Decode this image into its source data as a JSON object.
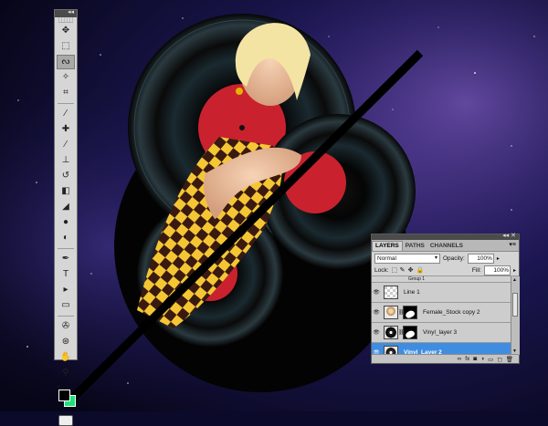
{
  "tools": {
    "header_glyph": "◂◂",
    "items": [
      {
        "name": "move-tool-icon",
        "glyph": "✥"
      },
      {
        "name": "marquee-tool-icon",
        "glyph": "⬚"
      },
      {
        "name": "lasso-tool-icon",
        "glyph": "ᔓ",
        "active": true
      },
      {
        "name": "magic-wand-tool-icon",
        "glyph": "✧"
      },
      {
        "name": "crop-tool-icon",
        "glyph": "⌗"
      },
      {
        "name": "eyedropper-tool-icon",
        "glyph": "⁄"
      },
      {
        "name": "healing-brush-tool-icon",
        "glyph": "✚"
      },
      {
        "name": "brush-tool-icon",
        "glyph": "⁄"
      },
      {
        "name": "clone-stamp-tool-icon",
        "glyph": "⊥"
      },
      {
        "name": "history-brush-tool-icon",
        "glyph": "↺"
      },
      {
        "name": "eraser-tool-icon",
        "glyph": "◧"
      },
      {
        "name": "paint-bucket-tool-icon",
        "glyph": "◢"
      },
      {
        "name": "blur-tool-icon",
        "glyph": "●"
      },
      {
        "name": "dodge-tool-icon",
        "glyph": "◐"
      },
      {
        "name": "pen-tool-icon",
        "glyph": "✒"
      },
      {
        "name": "type-tool-icon",
        "glyph": "T"
      },
      {
        "name": "path-selection-tool-icon",
        "glyph": "▸"
      },
      {
        "name": "shape-tool-icon",
        "glyph": "▭"
      },
      {
        "name": "3d-rotate-tool-icon",
        "glyph": "✇"
      },
      {
        "name": "3d-orbit-tool-icon",
        "glyph": "⊛"
      },
      {
        "name": "hand-tool-icon",
        "glyph": "✋"
      },
      {
        "name": "zoom-tool-icon",
        "glyph": "⚲"
      }
    ]
  },
  "colors": {
    "foreground": "#000000",
    "background": "#1de27a",
    "accent_selection": "#3f8de0"
  },
  "layers_panel": {
    "header_glyph": "◂◂ ✕",
    "tabs": [
      {
        "label": "LAYERS",
        "active": true
      },
      {
        "label": "PATHS",
        "active": false
      },
      {
        "label": "CHANNELS",
        "active": false
      }
    ],
    "menu_glyph": "▾≡",
    "blend_mode": "Normal",
    "opacity_label": "Opacity:",
    "opacity_value": "100%",
    "lock_label": "Lock:",
    "fill_label": "Fill:",
    "fill_value": "100%",
    "group_label": "Group 1",
    "layers": [
      {
        "name": "Line 1",
        "thumb": "transparent",
        "mask": false,
        "selected": false
      },
      {
        "name": "Female_Stock copy 2",
        "thumb": "photo",
        "mask": true,
        "selected": false
      },
      {
        "name": "Vinyl_layer 3",
        "thumb": "vinyl",
        "mask": true,
        "selected": false
      },
      {
        "name": "Vinyl_Layer 2",
        "thumb": "vinylsel",
        "mask": false,
        "selected": true
      }
    ],
    "footer_icons": [
      "link-layers-icon",
      "fx-icon",
      "add-mask-icon",
      "adjustment-layer-icon",
      "new-group-icon",
      "new-layer-icon",
      "delete-layer-icon"
    ],
    "footer_glyphs": [
      "∞",
      "fx",
      "◙",
      "◑",
      "▭",
      "◻",
      "🗑"
    ]
  }
}
